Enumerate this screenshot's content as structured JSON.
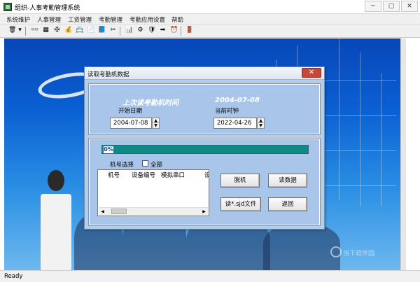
{
  "window": {
    "title": "组织-人事考勤管理系统",
    "minimize": "─",
    "maximize": "▢",
    "close": "✕"
  },
  "menu": [
    "系统维护",
    "人事管理",
    "工资管理",
    "考勤管理",
    "考勤应用设置",
    "帮助"
  ],
  "toolbar_icons": [
    "trash-icon",
    "chevron-down-icon",
    "glasses-icon",
    "grid-icon",
    "stamp-icon",
    "money-bag-icon",
    "card-reader-icon",
    "document-icon",
    "book-icon",
    "calculator-icon",
    "chart-icon",
    "seal-icon",
    "shield-icon",
    "arrow-right-icon",
    "clock-icon",
    "arrow-icon",
    "exit-door-icon"
  ],
  "toolbar_glyphs": [
    "🗑",
    "▾",
    "👓",
    "▦",
    "✠",
    "💰",
    "📇",
    "📄",
    "📘",
    "✂",
    "📊",
    "⚙",
    "🛡",
    "➡",
    "⏰",
    "➡",
    "🚪"
  ],
  "statusbar": {
    "text": "Ready"
  },
  "watermark": {
    "text": "当下软件园"
  },
  "dialog": {
    "title": "读取考勤机数据",
    "close": "✕",
    "last_read_label": "上次读考勤机时间",
    "last_read_value": "2004-07-08",
    "start_date_label": "开始日期",
    "start_date_value": "2004-07-08",
    "current_clock_label": "当前时钟",
    "current_clock_value": "2022-04-26",
    "progress_text": "0%",
    "progress": 0,
    "machine_select_label": "机号选择",
    "select_all_label": "全部",
    "select_all_checked": false,
    "list_columns": [
      "机号",
      "设备编号",
      "模拟串口",
      "设"
    ],
    "buttons": {
      "offline": "脱机",
      "read_data": "读数据",
      "read_sjd": "读*.sjd文件",
      "back": "返回"
    }
  }
}
